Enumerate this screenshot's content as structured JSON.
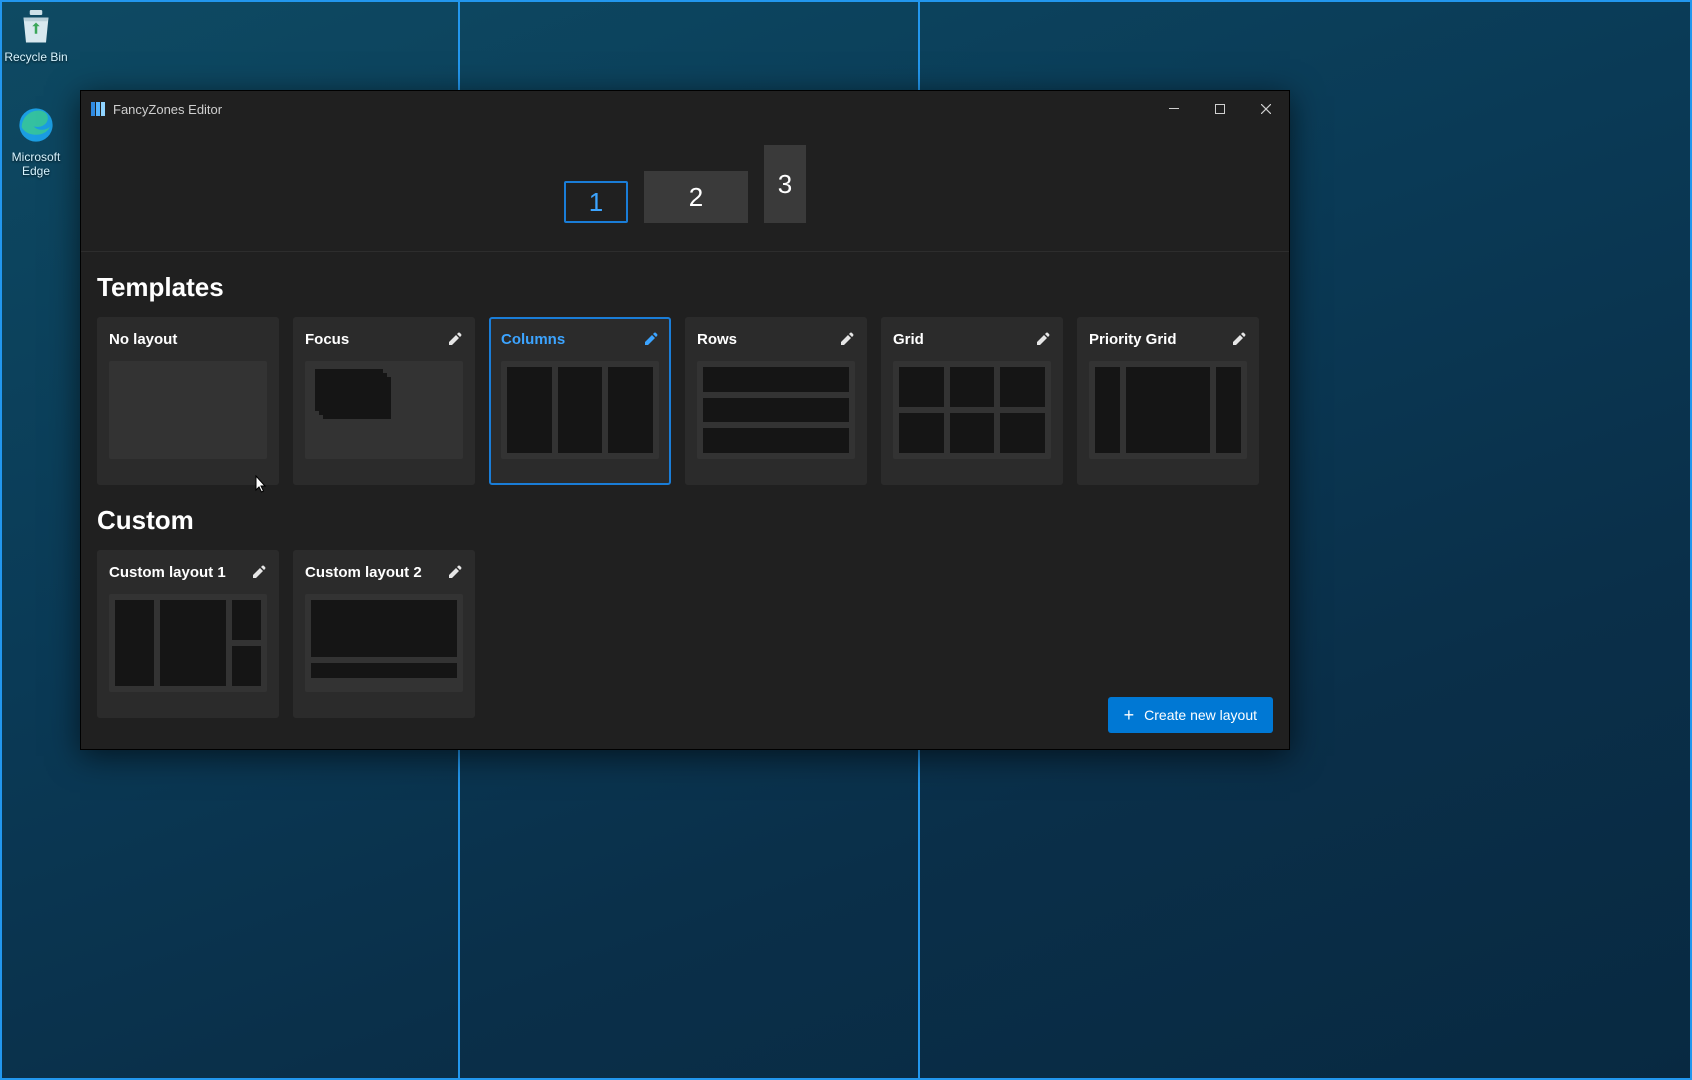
{
  "desktop": {
    "icons": {
      "recycle_bin": "Recycle Bin",
      "edge": "Microsoft Edge"
    }
  },
  "window": {
    "title": "FancyZones Editor",
    "monitors": [
      "1",
      "2",
      "3"
    ],
    "selected_monitor": 0,
    "templates_heading": "Templates",
    "custom_heading": "Custom",
    "templates": {
      "no_layout": "No layout",
      "focus": "Focus",
      "columns": "Columns",
      "rows": "Rows",
      "grid": "Grid",
      "priority_grid": "Priority Grid"
    },
    "selected_template": "columns",
    "custom_layouts": {
      "c1": "Custom layout 1",
      "c2": "Custom layout 2"
    },
    "create_button": "Create new layout"
  }
}
